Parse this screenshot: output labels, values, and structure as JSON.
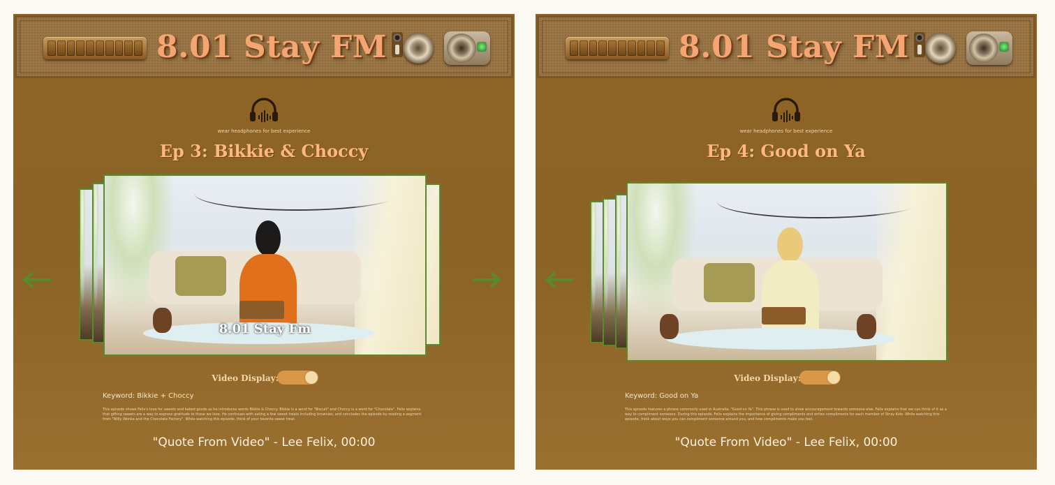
{
  "brand_color": "#f5a572",
  "accent_color": "#5a8a2e",
  "panels": [
    {
      "station_title": "8.01 Stay FM",
      "headphone_hint": "wear headphones for best experience",
      "episode_title": "Ep 3: Bikkie & Choccy",
      "video_watermark": "8.01 Stay Fm",
      "video_display_label": "Video Display:",
      "video_display_on": true,
      "keyword": "Keyword: Bikkie + Choccy",
      "description": "This episode shows Felix's love for sweets and baked goods as he introduces words Bikkie & Choccy. Bikkie is a word for \"Biscuit\" and Choccy is a word for \"Chocolate\". Felix explains that gifting sweets are a way to express gratitude to those we love. He continues with eating a few sweet treats including brownies, and concludes the episode by reading a segment from \"Willy Wonka and the Chocolate Factory\". While watching this episode, think of your favorite sweet treat.",
      "quote": "\"Quote From Video\" - Lee Felix, 00:00",
      "icons": {
        "prev": "arrow-left-icon",
        "next": "arrow-right-icon",
        "headphones": "headphones-icon"
      }
    },
    {
      "station_title": "8.01 Stay FM",
      "headphone_hint": "wear headphones for best experience",
      "episode_title": "Ep 4: Good on Ya",
      "video_watermark": "",
      "video_display_label": "Video Display:",
      "video_display_on": true,
      "keyword": "Keyword: Good on Ya",
      "description": "This episode features a phrase commonly used in Australia: \"Good on Ya\". This phrase is used to show encouragement towards someone else. Felix explains that we can think of it as a way to compliment someone. During this episode, Felix explains the importance of giving compliments and writes compliments for each member of Stray Kids. While watching this episode, think about ways you can compliment someone around you, and how compliments make you feel.",
      "quote": "\"Quote From Video\" - Lee Felix, 00:00",
      "icons": {
        "prev": "arrow-left-icon",
        "headphones": "headphones-icon"
      }
    }
  ]
}
